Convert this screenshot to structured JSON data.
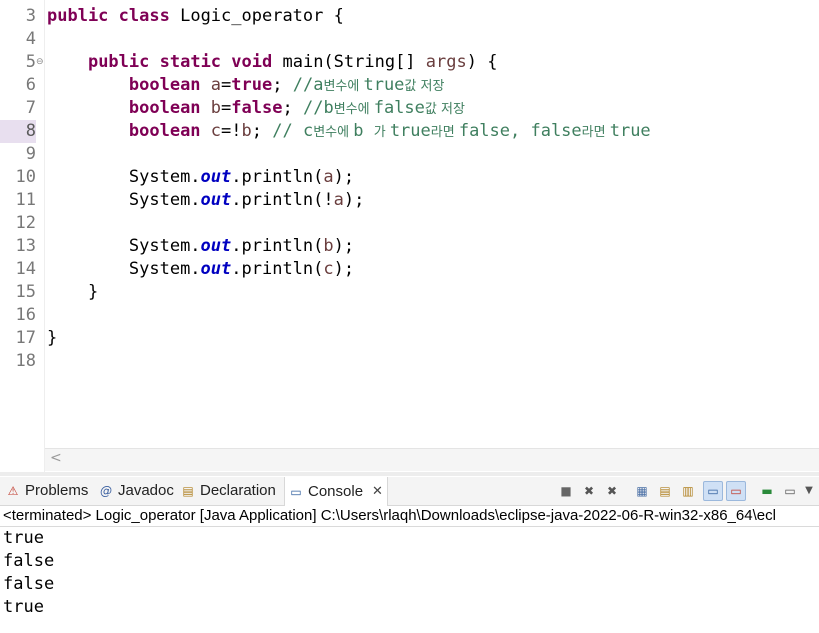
{
  "editor": {
    "line_numbers": [
      "3",
      "4",
      "5",
      "6",
      "7",
      "8",
      "9",
      "10",
      "11",
      "12",
      "13",
      "14",
      "15",
      "16",
      "17",
      "18"
    ],
    "active_line": "8",
    "code": {
      "l3": {
        "kw1": "public",
        "kw2": "class",
        "rest": " Logic_operator {"
      },
      "l5": {
        "kw1": "public",
        "kw2": "static",
        "kw3": "void",
        "mid": " main(String[] ",
        "var": "args",
        "end": ") {"
      },
      "l6": {
        "kw": "boolean",
        "var": "a",
        "eq": "=",
        "val": "true",
        "semi": ";",
        "c1": " //a",
        "c2": "변수에 ",
        "c3": "true",
        "c4": "값 저장"
      },
      "l7": {
        "kw": "boolean",
        "var": "b",
        "eq": "=",
        "val": "false",
        "semi": ";",
        "c1": " //b",
        "c2": "변수에 ",
        "c3": "false",
        "c4": "값 저장"
      },
      "l8": {
        "kw": "boolean",
        "var": "c",
        "eq": "=!",
        "var2": "b",
        "semi": ";",
        "c1": " // c",
        "c2": "변수에 ",
        "c3": "b ",
        "c4": "가 ",
        "c5": "true",
        "c6": "라면 ",
        "c7": "false, false",
        "c8": "라면 ",
        "c9": "true"
      },
      "l10": {
        "pre": "System.",
        "fld": "out",
        "post": ".println(",
        "arg": "a",
        "end": ");"
      },
      "l11": {
        "pre": "System.",
        "fld": "out",
        "post": ".println(!",
        "arg": "a",
        "end": ");"
      },
      "l13": {
        "pre": "System.",
        "fld": "out",
        "post": ".println(",
        "arg": "b",
        "end": ");"
      },
      "l14": {
        "pre": "System.",
        "fld": "out",
        "post": ".println(",
        "arg": "c",
        "end": ");"
      },
      "l15": "}",
      "l17": "}"
    },
    "scroll_left_glyph": "<"
  },
  "console_view": {
    "tabs": [
      {
        "label": "Problems",
        "icon": "problems-icon"
      },
      {
        "label": "Javadoc",
        "icon": "javadoc-icon"
      },
      {
        "label": "Declaration",
        "icon": "declaration-icon"
      },
      {
        "label": "Console",
        "icon": "console-icon",
        "active": true
      }
    ],
    "status": "<terminated> Logic_operator [Java Application] C:\\Users\\rlaqh\\Downloads\\eclipse-java-2022-06-R-win32-x86_64\\ecl",
    "output": [
      "true",
      "false",
      "false",
      "true"
    ]
  },
  "colors": {
    "keyword": "#7f0055",
    "comment": "#3f7f5f",
    "field": "#0000c0",
    "local_var": "#6a3e3e",
    "active_line_bg": "#e8dfef"
  }
}
